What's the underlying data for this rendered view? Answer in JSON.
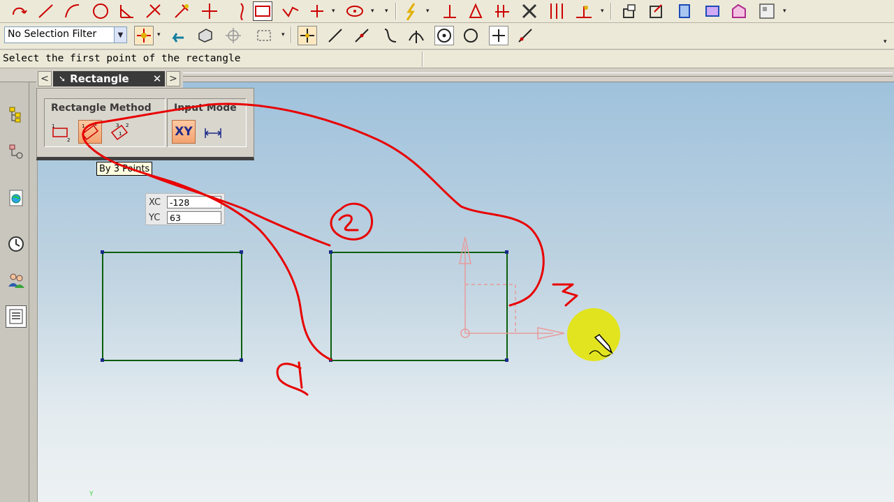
{
  "toolbar_row1": {
    "icons": [
      "undo-arc-icon",
      "line-tool-icon",
      "arc-tool-icon",
      "circle-tool-icon",
      "angle-tool-icon",
      "fillet-tool-icon",
      "trim-tool-icon",
      "point-tool-icon",
      "curve-tool-icon",
      "rectangle-tool-icon",
      "spline-tool-icon",
      "plus-point-icon",
      "ellipse-tool-icon",
      "constraint-tool-icon",
      "perpendicular-constraint-icon",
      "dimension-icon",
      "parallel-icon",
      "delete-constraint-icon",
      "offset-icon",
      "snap-angle-icon",
      "sketch-view-icon",
      "reattach-icon",
      "update-icon",
      "solid-icon",
      "tool-settings-icon"
    ]
  },
  "toolbar_row2": {
    "selection_filter": "No Selection Filter",
    "snap_icons": [
      "snap-enable-icon",
      "undo-arrow-icon",
      "select-3d-icon",
      "selection-crosshair-icon",
      "rectangle-select-icon",
      "snap-point-icon",
      "end-point-icon",
      "mid-point-icon",
      "control-point-icon",
      "intersection-icon",
      "arc-center-icon",
      "quadrant-icon",
      "existing-point-icon",
      "point-on-curve-icon"
    ]
  },
  "status": {
    "prompt": "Select the first point of the rectangle"
  },
  "dialog": {
    "title": "Rectangle",
    "method_label": "Rectangle Method",
    "input_label": "Input Mode",
    "input_xy": "XY",
    "tooltip": "By 3 Points"
  },
  "coords": {
    "xc_label": "XC",
    "xc_value": "-128",
    "yc_label": "YC",
    "yc_value": "63"
  },
  "viewport": {
    "y_marker": "Y"
  },
  "annotations": {
    "n1": "1",
    "n2": "2",
    "n3": "3"
  },
  "colors": {
    "sketch_green": "#0b5e0b",
    "annotation_red": "#e80000",
    "cursor_highlight": "#e3e40d",
    "dialog_active": "#f3a370"
  }
}
